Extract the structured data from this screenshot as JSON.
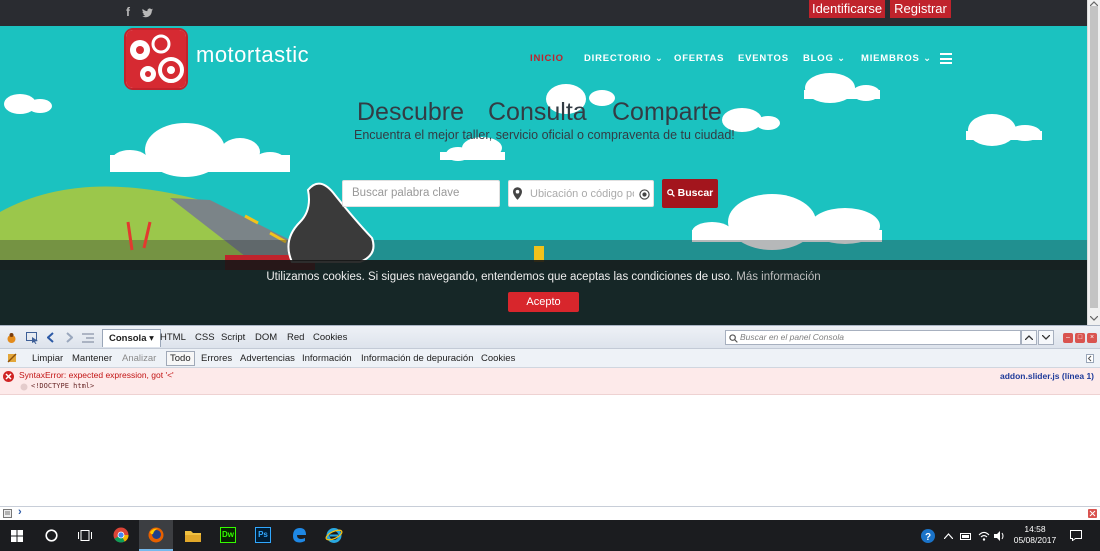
{
  "site": {
    "social": {
      "facebook": "f",
      "twitter": "twitter-icon"
    },
    "top_buttons": {
      "login": "Identificarse",
      "register": "Registrar"
    },
    "logo": {
      "text": "motortastic"
    },
    "nav": [
      {
        "label": "INICIO",
        "active": true
      },
      {
        "label": "DIRECTORIO ⌄"
      },
      {
        "label": "OFERTAS"
      },
      {
        "label": "EVENTOS"
      },
      {
        "label": "BLOG ⌄"
      },
      {
        "label": "MIEMBROS ⌄"
      }
    ],
    "hero": {
      "words": [
        "Descubre",
        "Consulta",
        "Comparte"
      ],
      "subtitle": "Encuentra el mejor taller, servicio oficial o compraventa de tu ciudad!"
    },
    "search": {
      "keyword_placeholder": "Buscar palabra clave",
      "location_placeholder": "Ubicación o código postal",
      "button": "Buscar"
    },
    "cookie": {
      "text": "Utilizamos cookies. Si sigues navegando, entendemos que aceptas las condiciones de uso.",
      "more": "Más información",
      "accept": "Acepto"
    },
    "colors": {
      "teal": "#1bc2c0",
      "brand_red": "#c0232c"
    }
  },
  "firebug": {
    "tabs": [
      "Consola ▾",
      "HTML",
      "CSS",
      "Script",
      "DOM",
      "Red",
      "Cookies"
    ],
    "search_placeholder": "Buscar en el panel Consola",
    "filters": [
      "Limpiar",
      "Mantener",
      "Analizar",
      "Todo",
      "Errores",
      "Advertencias",
      "Información",
      "Información de depuración",
      "Cookies"
    ],
    "error": {
      "message": "SyntaxError: expected expression, got '<'",
      "source": "<!DOCTYPE html>",
      "location": "addon.slider.js (línea 1)"
    },
    "prompt": "›"
  },
  "taskbar": {
    "apps": [
      "start-icon",
      "search-icon",
      "task-view-icon",
      "chrome-icon",
      "firefox-icon",
      "file-explorer-icon",
      "dreamweaver-icon",
      "photoshop-icon",
      "edge-icon",
      "internet-explorer-icon"
    ],
    "dw": "Dw",
    "ps": "Ps",
    "clock": {
      "time": "14:58",
      "date": "05/08/2017"
    }
  }
}
